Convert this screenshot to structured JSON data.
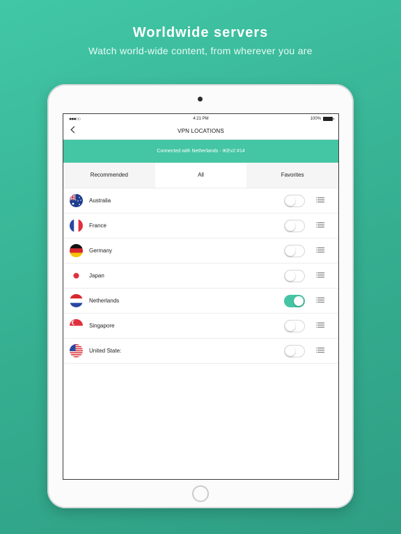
{
  "promo": {
    "title": "Worldwide servers",
    "subtitle": "Watch world-wide content, from wherever you are"
  },
  "status_bar": {
    "signal": "●●●○○",
    "time": "4:21 PM",
    "battery": "100%"
  },
  "nav": {
    "title": "VPN LOCATIONS"
  },
  "banner": {
    "text": "Connected with Netherlands - IKEv2 #14"
  },
  "tabs": [
    {
      "label": "Recommended",
      "active": false
    },
    {
      "label": "All",
      "active": true
    },
    {
      "label": "Favorites",
      "active": false
    }
  ],
  "locations": [
    {
      "name": "Australia",
      "connected": false,
      "flag": "australia-flag-icon"
    },
    {
      "name": "France",
      "connected": false,
      "flag": "france-flag-icon"
    },
    {
      "name": "Germany",
      "connected": false,
      "flag": "germany-flag-icon"
    },
    {
      "name": "Japan",
      "connected": false,
      "flag": "japan-flag-icon"
    },
    {
      "name": "Netherlands",
      "connected": true,
      "flag": "netherlands-flag-icon"
    },
    {
      "name": "Singapore",
      "connected": false,
      "flag": "singapore-flag-icon"
    },
    {
      "name": "United State:",
      "connected": false,
      "flag": "united-states-flag-icon"
    }
  ],
  "colors": {
    "accent": "#44c5a4",
    "background": "#3bb898"
  }
}
